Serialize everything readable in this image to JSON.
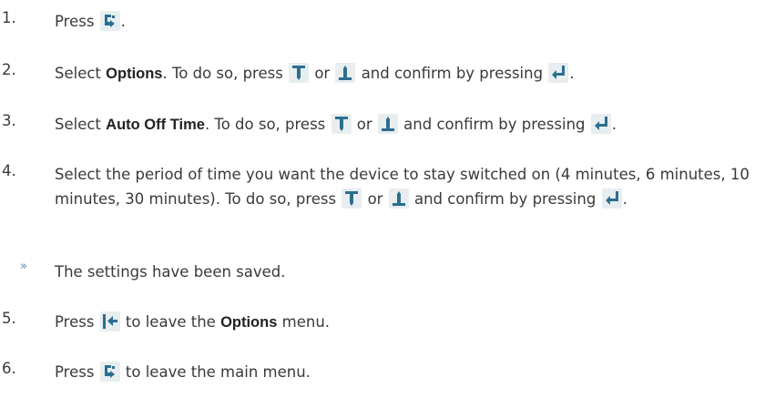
{
  "steps": [
    {
      "num": "1.",
      "parts": [
        "Press ",
        "."
      ]
    },
    {
      "num": "2.",
      "a": "Select ",
      "b": "Options",
      "c": ". To do so, press ",
      "d": " or ",
      "e": " and confirm by pressing ",
      "f": "."
    },
    {
      "num": "3.",
      "a": "Select ",
      "b": "Auto Off Time",
      "c": ". To do so, press ",
      "d": " or ",
      "e": " and confirm by pressing ",
      "f": "."
    },
    {
      "num": "4.",
      "a": "Select the period of time you want the device to stay switched on (4 minutes, 6 minutes, 10 minutes, 30 minutes). To do so, press ",
      "d": " or ",
      "e": " and confirm by pressing ",
      "f": "."
    },
    {
      "num": "5.",
      "a": "Press ",
      "c": " to leave the ",
      "b": "Options",
      "e": " menu."
    },
    {
      "num": "6.",
      "a": "Press ",
      "c": " to leave the main menu."
    }
  ],
  "result": {
    "bullet": "»",
    "text": "The settings have been saved."
  },
  "icons": {
    "menu": "menu-icon",
    "down": "arrow-down-icon",
    "up": "arrow-up-icon",
    "enter": "enter-icon",
    "back": "back-icon"
  }
}
